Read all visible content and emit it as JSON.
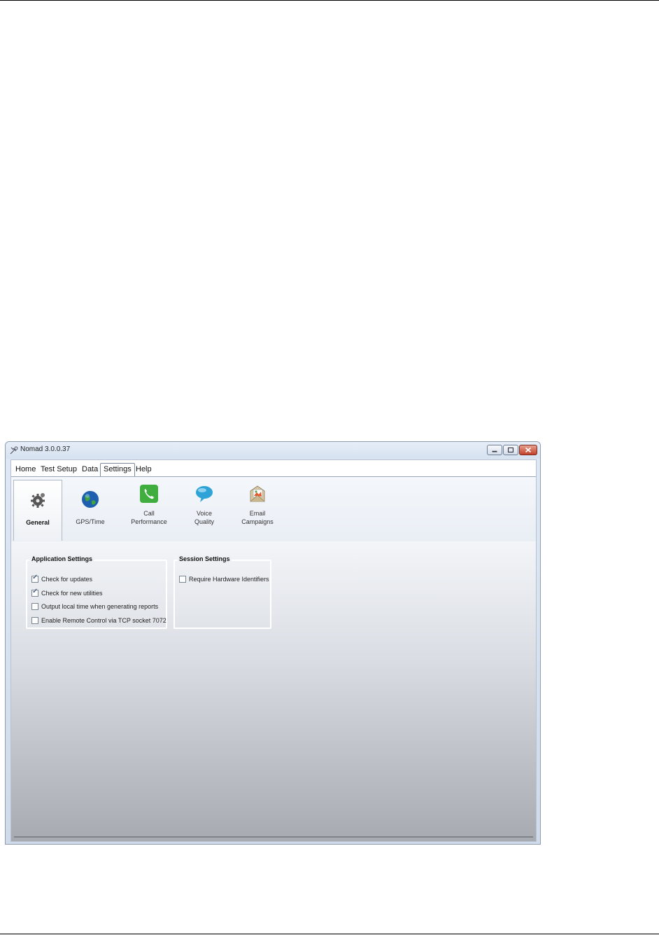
{
  "window": {
    "title": "Nomad 3.0.0.37"
  },
  "menu": {
    "items": [
      {
        "label": "Home"
      },
      {
        "label": "Test Setup"
      },
      {
        "label": "Data"
      },
      {
        "label": "Settings",
        "active": true
      },
      {
        "label": "Help"
      }
    ]
  },
  "ribbon": {
    "buttons": [
      {
        "label": "General",
        "icon": "gear-icon",
        "selected": true
      },
      {
        "label": "GPS/Time",
        "icon": "globe-icon"
      },
      {
        "label_line1": "Call",
        "label_line2": "Performance",
        "icon": "phone-icon"
      },
      {
        "label_line1": "Voice",
        "label_line2": "Quality",
        "icon": "speech-bubble-icon"
      },
      {
        "label_line1": "Email",
        "label_line2": "Campaigns",
        "icon": "email-icon"
      }
    ]
  },
  "application_settings": {
    "title": "Application Settings",
    "options": [
      {
        "label": "Check for updates",
        "checked": true
      },
      {
        "label": "Check for new utilities",
        "checked": true
      },
      {
        "label": "Output local time when generating reports",
        "checked": false
      },
      {
        "label": "Enable Remote Control via TCP socket 7072",
        "checked": false
      }
    ]
  },
  "session_settings": {
    "title": "Session Settings",
    "options": [
      {
        "label": "Require Hardware Identifiers",
        "checked": false
      }
    ]
  },
  "colors": {
    "accent_green": "#3fae3f",
    "close_red": "#c1412a"
  },
  "check_mark": "✓"
}
